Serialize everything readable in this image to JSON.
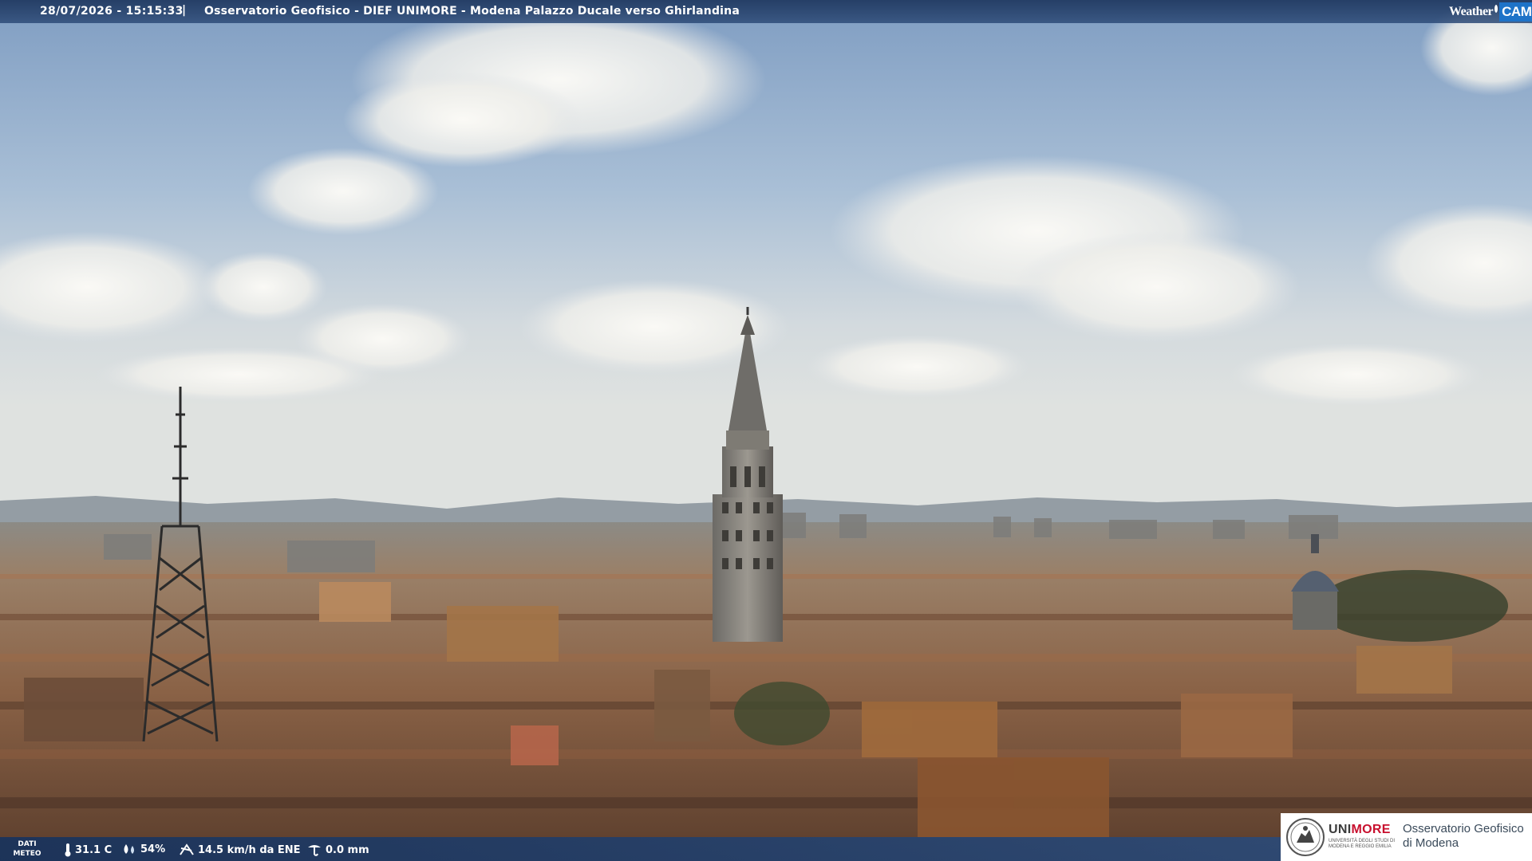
{
  "overlay": {
    "timestamp": "28/07/2026 - 15:15:33",
    "separator": "|",
    "title": "Osservatorio Geofisico - DIEF UNIMORE - Modena Palazzo Ducale verso Ghirlandina"
  },
  "brand": {
    "weather": "Weather",
    "cam": "CAM",
    "cam_color": "#1e73c8"
  },
  "weather": {
    "label_line1": "DATI",
    "label_line2": "METEO",
    "temperature": "31.1 C",
    "humidity": "54%",
    "wind": "14.5 km/h da ENE",
    "rain": "0.0 mm"
  },
  "institution": {
    "uni_prefix": "UNI",
    "uni_suffix": "MORE",
    "uni_sub_1": "UNIVERSITÀ DEGLI STUDI DI",
    "uni_sub_2": "MODENA E REGGIO EMILIA",
    "observatory_line1": "Osservatorio Geofisico",
    "observatory_line2": "di Modena",
    "accent_color": "#c8102e"
  },
  "scene": {
    "subject": "Ghirlandina tower and Modena rooftops",
    "sky_top_color": "#8aa6c8",
    "sky_horizon_color": "#dfe3e3",
    "roof_color": "#8a5a3a"
  }
}
